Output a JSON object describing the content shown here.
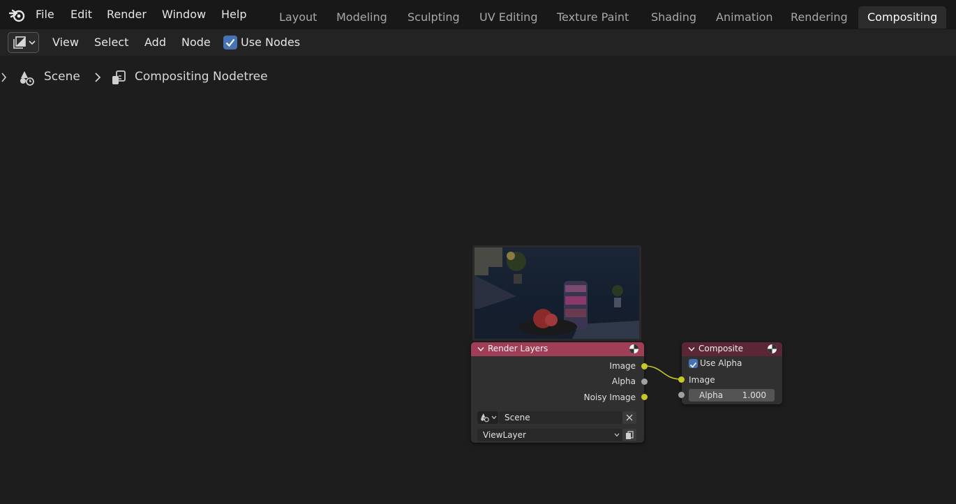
{
  "menubar": {
    "items": [
      "File",
      "Edit",
      "Render",
      "Window",
      "Help"
    ]
  },
  "workspace_tabs": [
    {
      "label": "Layout",
      "active": false
    },
    {
      "label": "Modeling",
      "active": false
    },
    {
      "label": "Sculpting",
      "active": false
    },
    {
      "label": "UV Editing",
      "active": false
    },
    {
      "label": "Texture Paint",
      "active": false
    },
    {
      "label": "Shading",
      "active": false
    },
    {
      "label": "Animation",
      "active": false
    },
    {
      "label": "Rendering",
      "active": false
    },
    {
      "label": "Compositing",
      "active": true
    }
  ],
  "editor_header": {
    "menus": [
      "View",
      "Select",
      "Add",
      "Node"
    ],
    "use_nodes_label": "Use Nodes",
    "use_nodes_checked": true
  },
  "breadcrumb": {
    "scene": "Scene",
    "nodetree": "Compositing Nodetree"
  },
  "render_layers_node": {
    "title": "Render Layers",
    "header_color": "#a13e57",
    "outputs": [
      "Image",
      "Alpha",
      "Noisy Image"
    ],
    "scene_field": "Scene",
    "view_layer": "ViewLayer"
  },
  "composite_node": {
    "title": "Composite",
    "header_color": "#5b2636",
    "use_alpha_label": "Use Alpha",
    "use_alpha_checked": true,
    "image_input": "Image",
    "alpha_label": "Alpha",
    "alpha_value": "1.000"
  },
  "colors": {
    "image_socket": "#c7c729",
    "value_socket": "#a1a1a1",
    "checkbox_accent": "#4772b3",
    "active_tab_bg": "#2c2c2c"
  },
  "icons": [
    "blender-logo-icon",
    "image-editor-icon",
    "chevron-down-icon",
    "checkmark-icon",
    "chevron-right-icon",
    "scene-icon",
    "nodetree-icon",
    "render-sphere-icon",
    "close-icon",
    "copy-icon"
  ]
}
